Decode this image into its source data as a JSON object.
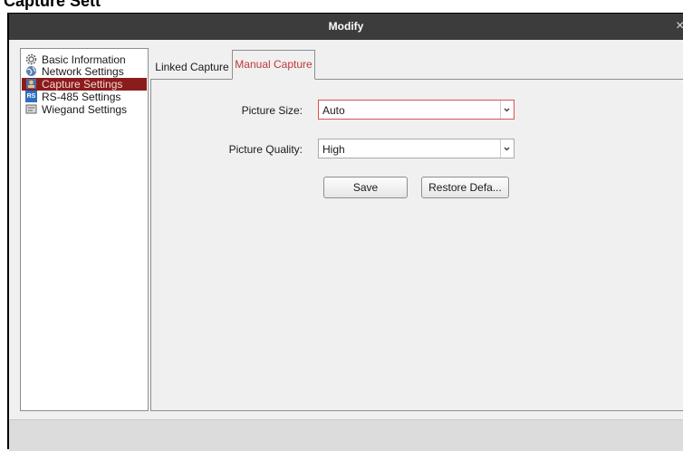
{
  "window": {
    "title": "Modify",
    "close_glyph": "×",
    "cropped_heading": "Capture Sett"
  },
  "sidebar": {
    "items": [
      {
        "label": "Basic Information",
        "icon": "gear-icon",
        "active": false
      },
      {
        "label": "Network Settings",
        "icon": "globe-icon",
        "active": false
      },
      {
        "label": "Capture Settings",
        "icon": "camera-icon",
        "active": true
      },
      {
        "label": "RS-485 Settings",
        "icon": "rs-icon",
        "icon_text": "RS",
        "active": false
      },
      {
        "label": "Wiegand Settings",
        "icon": "wiegand-icon",
        "active": false
      }
    ]
  },
  "tabs": [
    {
      "label": "Linked Capture",
      "active": false
    },
    {
      "label": "Manual Capture",
      "active": true
    }
  ],
  "form": {
    "picture_size": {
      "label": "Picture Size:",
      "value": "Auto"
    },
    "picture_quality": {
      "label": "Picture Quality:",
      "value": "High"
    }
  },
  "buttons": {
    "save": "Save",
    "restore": "Restore Defa..."
  },
  "colors": {
    "active_tab_text": "#c0393b",
    "active_nav_bg": "#8b1c1c",
    "titlebar": "#3c3c3c"
  }
}
